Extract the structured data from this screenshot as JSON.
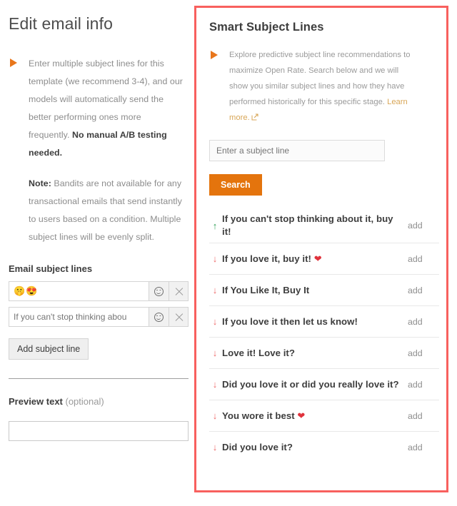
{
  "left": {
    "title": "Edit email info",
    "callout": {
      "bullet_icon": "triangle-right-icon",
      "paragraph1_pre": "Enter multiple subject lines for this template (we recommend 3-4), and our models will automatically send the better performing ones more frequently. ",
      "paragraph1_bold": "No manual A/B testing needed.",
      "paragraph2_bold": "Note:",
      "paragraph2_rest": " Bandits are not available for any transactional emails that send instantly to users based on a condition. Multiple subject lines will be evenly split."
    },
    "subject_lines_label": "Email subject lines",
    "subject_rows": [
      {
        "value": "🤫😍",
        "placeholder": "",
        "emoji_button": "emoji-picker-icon",
        "remove_button": "close-icon"
      },
      {
        "value": "If you can't stop thinking abou",
        "placeholder": "If you can't stop thinking abou",
        "emoji_button": "emoji-picker-icon",
        "remove_button": "close-icon"
      }
    ],
    "add_subject_label": "Add subject line",
    "preview_label_bold": "Preview text",
    "preview_label_muted": " (optional)",
    "preview_value": "",
    "preview_placeholder": ""
  },
  "right": {
    "title": "Smart Subject Lines",
    "bullet_icon": "triangle-right-icon",
    "description": "Explore predictive subject line recommendations to maximize Open Rate. Search below and we will show you similar subject lines and how they have performed historically for this specific stage. ",
    "learn_more_label": "Learn more.",
    "learn_more_icon": "external-link-icon",
    "search_placeholder": "Enter a subject line",
    "search_value": "",
    "search_button_label": "Search",
    "add_label": "add",
    "results": [
      {
        "text": "If you can't stop thinking about it, buy it!",
        "trend": "up",
        "trend_glyph": "↑",
        "emoji": ""
      },
      {
        "text": "If you love it, buy it! ",
        "trend": "down",
        "trend_glyph": "↓",
        "emoji": "❤"
      },
      {
        "text": "If You Like It, Buy It",
        "trend": "down",
        "trend_glyph": "↓",
        "emoji": ""
      },
      {
        "text": "If you love it then let us know!",
        "trend": "down",
        "trend_glyph": "↓",
        "emoji": ""
      },
      {
        "text": "Love it! Love it?",
        "trend": "down",
        "trend_glyph": "↓",
        "emoji": ""
      },
      {
        "text": "Did you love it or did you really love it?",
        "trend": "down",
        "trend_glyph": "↓",
        "emoji": ""
      },
      {
        "text": "You wore it best ",
        "trend": "down",
        "trend_glyph": "↓",
        "emoji": "❤"
      },
      {
        "text": "Did you love it?",
        "trend": "down",
        "trend_glyph": "↓",
        "emoji": ""
      }
    ]
  },
  "colors": {
    "accent_orange": "#e4740d",
    "highlight_red": "#f8605e",
    "trend_up_green": "#2f9e57",
    "trend_down_red": "#ee6a6a",
    "learn_more": "#d8a657"
  }
}
